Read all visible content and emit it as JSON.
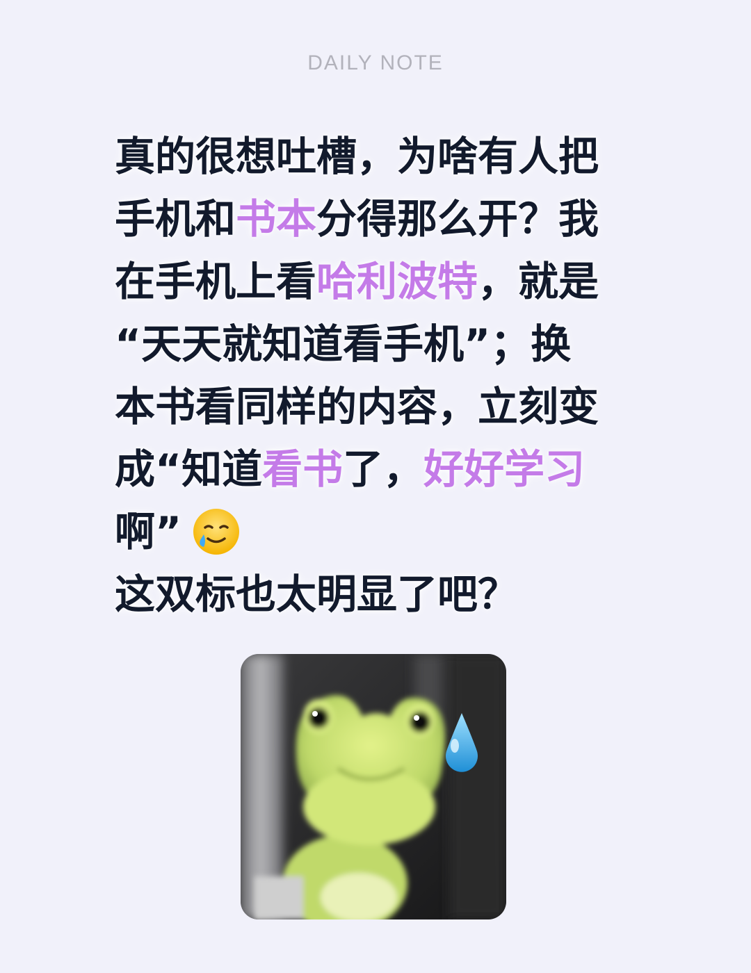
{
  "header": {
    "label": "DAILY  NOTE"
  },
  "note": {
    "lines": [
      [
        {
          "text": "真的很想吐槽，为啥有人把",
          "highlight": false
        }
      ],
      [
        {
          "text": "手机和",
          "highlight": false
        },
        {
          "text": "书本",
          "highlight": true
        },
        {
          "text": "分得那么开？我",
          "highlight": false
        }
      ],
      [
        {
          "text": "在手机上看",
          "highlight": false
        },
        {
          "text": "哈利波特",
          "highlight": true
        },
        {
          "text": "，就是",
          "highlight": false
        }
      ],
      [
        {
          "text": "“天天就知道看手机”；换",
          "highlight": false
        }
      ],
      [
        {
          "text": "本书看同样的内容，立刻变",
          "highlight": false
        }
      ],
      [
        {
          "text": "成“知道",
          "highlight": false
        },
        {
          "text": "看书",
          "highlight": true
        },
        {
          "text": "了，",
          "highlight": false
        },
        {
          "text": "好好学习",
          "highlight": true
        }
      ],
      [
        {
          "text": "啊”",
          "highlight": false
        }
      ],
      [
        {
          "text": "这双标也太明显了吧？",
          "highlight": false
        }
      ]
    ],
    "emoji_after_line": 6,
    "emoji_icon": "smiling-face-with-tear-icon"
  },
  "sticker": {
    "icon": "frog-sweat-drop-sticker"
  },
  "colors": {
    "background": "#f1f1fa",
    "text": "#121a2c",
    "highlight": "#c47be8",
    "header": "#b2b2bb"
  }
}
